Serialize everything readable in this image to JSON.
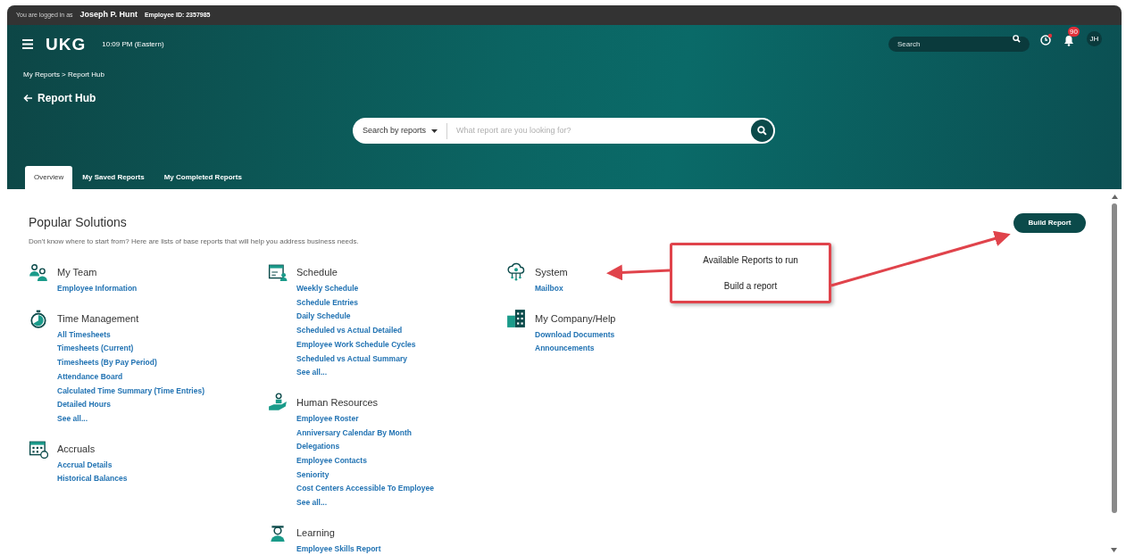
{
  "top_bar": {
    "logged_in_label": "You are logged in as",
    "user_name": "Joseph P. Hunt",
    "employee_id": "Employee ID: 2357985"
  },
  "header": {
    "logo": "UKG",
    "time": "10:09 PM (Eastern)",
    "search_placeholder": "Search",
    "notification_count": "90",
    "avatar": "JH",
    "breadcrumb": "My Reports > Report Hub",
    "page_title": "Report Hub"
  },
  "report_search": {
    "scope": "Search by reports",
    "placeholder": "What report are you looking for?"
  },
  "tabs": [
    {
      "label": "Overview",
      "selected": true
    },
    {
      "label": "My Saved Reports",
      "selected": false
    },
    {
      "label": "My Completed Reports",
      "selected": false
    }
  ],
  "popular": {
    "title": "Popular Solutions",
    "description": "Don't know where to start from? Here are lists of base reports that will help you address business needs.",
    "build_button": "Build Report"
  },
  "columns": [
    [
      {
        "title": "My Team",
        "links": [
          "Employee Information"
        ]
      },
      {
        "title": "Time Management",
        "links": [
          "All Timesheets",
          "Timesheets (Current)",
          "Timesheets (By Pay Period)",
          "Attendance Board",
          "Calculated Time Summary (Time Entries)",
          "Detailed Hours",
          "See all..."
        ]
      },
      {
        "title": "Accruals",
        "links": [
          "Accrual Details",
          "Historical Balances"
        ]
      }
    ],
    [
      {
        "title": "Schedule",
        "links": [
          "Weekly Schedule",
          "Schedule Entries",
          "Daily Schedule",
          "Scheduled vs Actual Detailed",
          "Employee Work Schedule Cycles",
          "Scheduled vs Actual Summary",
          "See all..."
        ]
      },
      {
        "title": "Human Resources",
        "links": [
          "Employee Roster",
          "Anniversary Calendar By Month",
          "Delegations",
          "Employee Contacts",
          "Seniority",
          "Cost Centers Accessible To Employee",
          "See all..."
        ]
      },
      {
        "title": "Learning",
        "links": [
          "Employee Skills Report"
        ]
      }
    ],
    [
      {
        "title": "System",
        "links": [
          "Mailbox"
        ]
      },
      {
        "title": "My Company/Help",
        "links": [
          "Download Documents",
          "Announcements"
        ]
      }
    ]
  ],
  "callout": {
    "lines": [
      "Available Reports to run",
      "Build a report"
    ]
  }
}
